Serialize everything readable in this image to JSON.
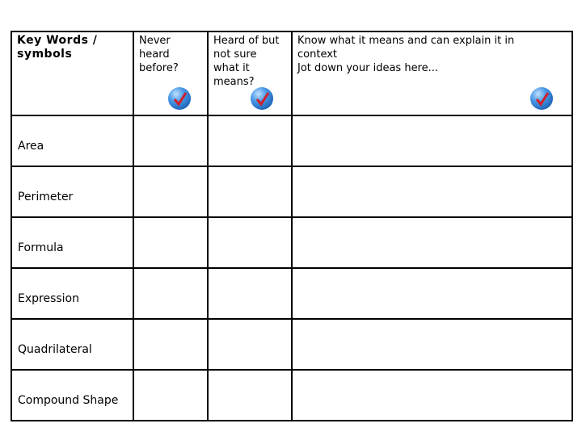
{
  "header": {
    "key_words": "Key Words /\nsymbols",
    "never_heard": "Never\nheard\nbefore?",
    "heard_not_sure": "Heard of but\nnot sure\nwhat it\nmeans?",
    "know_meaning": "Know what it means and can explain it in\ncontext\nJot down your ideas here...",
    "icon": "checkmark-globe-icon",
    "icon_color": "#2f7fd6",
    "check_color": "#d0202a"
  },
  "rows": [
    {
      "word": "Area"
    },
    {
      "word": "Perimeter"
    },
    {
      "word": "Formula"
    },
    {
      "word": "Expression"
    },
    {
      "word": "Quadrilateral"
    },
    {
      "word": "Compound Shape"
    }
  ]
}
